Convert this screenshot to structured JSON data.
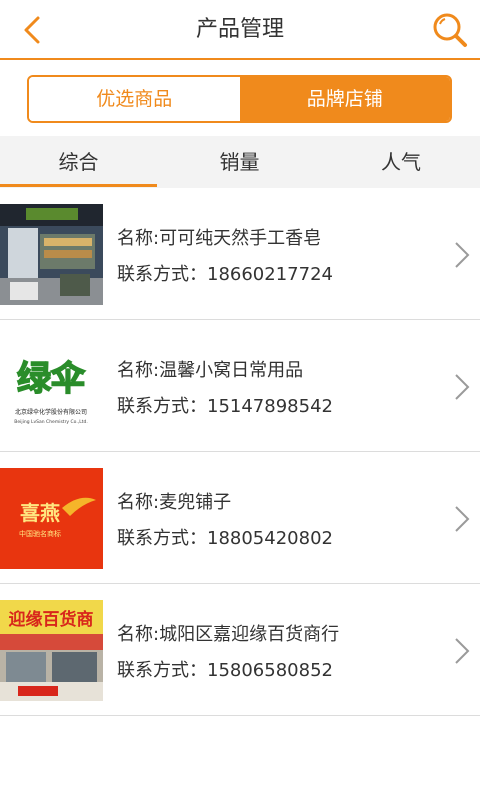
{
  "header": {
    "title": "产品管理",
    "back_icon": "chevron-left-icon",
    "search_icon": "search-icon",
    "accent": "#f08a1c"
  },
  "segment": {
    "left_label": "优选商品",
    "right_label": "品牌店铺",
    "active": "right"
  },
  "sort_tabs": [
    {
      "label": "综合",
      "active": true
    },
    {
      "label": "销量",
      "active": false
    },
    {
      "label": "人气",
      "active": false
    }
  ],
  "stores": [
    {
      "name": "名称:可可纯天然手工香皂",
      "contact": "联系方式：18660217724",
      "thumb_text": ""
    },
    {
      "name": "名称:温馨小窝日常用品",
      "contact": "联系方式：15147898542",
      "thumb_text": "绿伞",
      "thumb_sub": "北京绿伞化学股份有限公司",
      "thumb_sub2": "Beijing LvSan Chemistry Co.,Ltd."
    },
    {
      "name": "名称:麦兜铺子",
      "contact": "联系方式：18805420802",
      "thumb_text": "喜燕",
      "thumb_sub": "中国驰名商标"
    },
    {
      "name": "名称:城阳区嘉迎缘百货商行",
      "contact": "联系方式：15806580852",
      "thumb_text": "迎缘百货商"
    }
  ]
}
